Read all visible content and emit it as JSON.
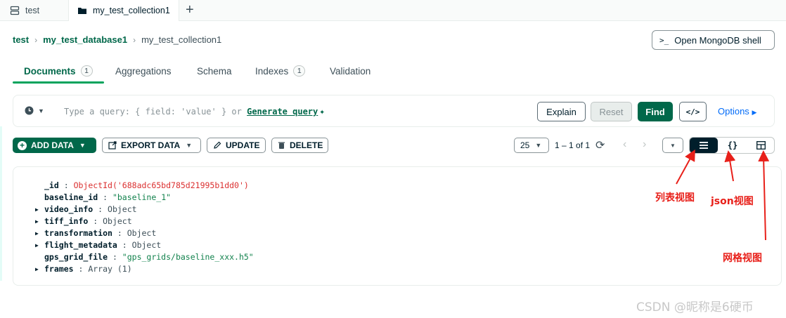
{
  "tabs": [
    {
      "label": "test",
      "icon": "database-icon"
    },
    {
      "label": "my_test_collection1",
      "icon": "folder-icon"
    }
  ],
  "new_tab_label": "+",
  "breadcrumb": [
    "test",
    "my_test_database1",
    "my_test_collection1"
  ],
  "shell_button": {
    "prompt": ">_",
    "label": "Open MongoDB shell"
  },
  "subtabs": [
    {
      "label": "Documents",
      "badge": "1"
    },
    {
      "label": "Aggregations"
    },
    {
      "label": "Schema"
    },
    {
      "label": "Indexes",
      "badge": "1"
    },
    {
      "label": "Validation"
    }
  ],
  "query": {
    "placeholder": "Type a query: { field: 'value' } or",
    "generate_label": "Generate query",
    "explain": "Explain",
    "reset": "Reset",
    "find": "Find",
    "code": "</>",
    "options": "Options"
  },
  "actions": {
    "add_data": "ADD DATA",
    "export_data": "EXPORT DATA",
    "update": "UPDATE",
    "delete": "DELETE"
  },
  "pagination": {
    "page_size": "25",
    "range": "1 – 1 of 1"
  },
  "document": [
    {
      "key": "_id",
      "value": "ObjectId('688adc65bd785d21995b1dd0')",
      "type": "oid",
      "expandable": false
    },
    {
      "key": "baseline_id",
      "value": "\"baseline_1\"",
      "type": "str",
      "expandable": false
    },
    {
      "key": "video_info",
      "value": "Object",
      "type": "obj",
      "expandable": true
    },
    {
      "key": "tiff_info",
      "value": "Object",
      "type": "obj",
      "expandable": true
    },
    {
      "key": "transformation",
      "value": "Object",
      "type": "obj",
      "expandable": true
    },
    {
      "key": "flight_metadata",
      "value": "Object",
      "type": "obj",
      "expandable": true
    },
    {
      "key": "gps_grid_file",
      "value": "\"gps_grids/baseline_xxx.h5\"",
      "type": "str",
      "expandable": false
    },
    {
      "key": "frames",
      "value": "Array (1)",
      "type": "obj",
      "expandable": true
    }
  ],
  "annotations": {
    "list_view": "列表视图",
    "json_view": "json视图",
    "grid_view": "网格视图"
  },
  "watermark": "CSDN @昵称是6硬币",
  "colors": {
    "brand_green": "#00684a",
    "active_underline": "#00a35c",
    "annotation_red": "#e8201a"
  }
}
